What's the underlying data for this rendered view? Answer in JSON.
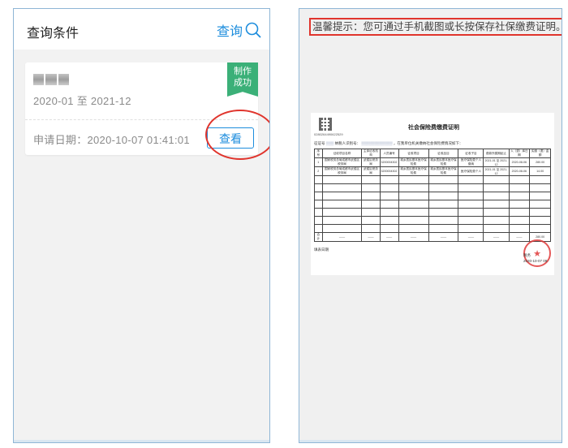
{
  "left": {
    "header": {
      "title": "查询条件",
      "query_label": "查询"
    },
    "record": {
      "period": "2020-01 至 2021-12",
      "status_badge": "制作\n成功",
      "apply_date": "申请日期：2020-10-07 01:41:01",
      "view_label": "查看"
    }
  },
  "right": {
    "tip": "温馨提示：您可通过手机截图或长按保存社保缴费证明。",
    "doc": {
      "qr_number": "0280264490622529",
      "title": "社会保险费缴费证明",
      "line_prefix": "征证号",
      "line_middle": "纳税人识别号：",
      "line_suffix": "，在我单位机关缴纳社会保险费情况如下：",
      "headers": [
        "序号",
        "征收项目名称",
        "主体征收机构",
        "人员编号",
        "征收项目",
        "征收品目",
        "征收子目",
        "费款所属期起止",
        "入（退）库日期",
        "实缴（退）金额"
      ],
      "rows": [
        [
          "1",
          "国家税务总局成都市武侯区税务局",
          "武侯区税务局",
          "3200004302",
          "城乡居民基本医疗保险费",
          "城乡居民基本医疗保险费",
          "医疗保险费个人缴纳",
          "2021-01 至 2021-12",
          "2020-08-06",
          "280.00"
        ],
        [
          "2",
          "国家税务总局成都市武侯区税务局",
          "武侯区税务局",
          "3200004302",
          "城乡居民基本医疗保险费",
          "城乡居民基本医疗保险费",
          "医疗保险费个人",
          "2021-01 至 2021-12",
          "2020-08-06",
          "14.00"
        ]
      ],
      "total_label": "合计",
      "total_value": "280.00",
      "bottom_label": "填表日期",
      "sign_text": "税务",
      "sign_date": "2020-10-07 09:"
    }
  }
}
